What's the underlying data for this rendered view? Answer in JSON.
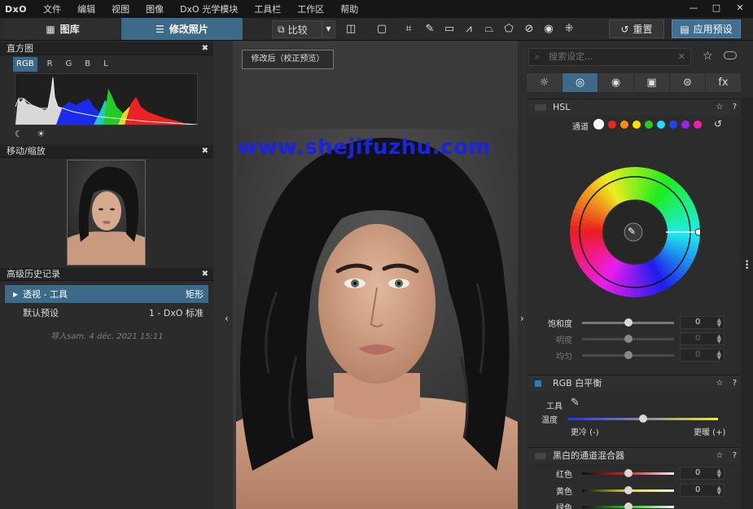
{
  "app": {
    "logo": "DxO",
    "menu": [
      "文件",
      "编辑",
      "视图",
      "图像",
      "DxO 光学模块",
      "工具栏",
      "工作区",
      "帮助"
    ],
    "window_controls": [
      "—",
      "□",
      "✕"
    ]
  },
  "toolbar": {
    "tab_library": "图库",
    "tab_edit": "修改照片",
    "compare_label": "比较",
    "reset_label": "重置",
    "apply_preset_label": "应用预设"
  },
  "histogram": {
    "title": "直方图",
    "channels": [
      "RGB",
      "R",
      "G",
      "B",
      "L"
    ],
    "active_channel": "RGB"
  },
  "navigator": {
    "title": "移动/缩放"
  },
  "history": {
    "title": "高级历史记录",
    "items": [
      {
        "label": "透视 - 工具",
        "value": "矩形",
        "selected": true
      },
      {
        "label": "默认预设",
        "value": "1 - DxO 标准",
        "selected": false
      }
    ],
    "import_note": "导入sam. 4 déc. 2021 15:11"
  },
  "viewer": {
    "corrected_label": "修改后（校正预览）",
    "watermark": "www.shejifuzhu.com"
  },
  "right_panel": {
    "search_placeholder": "搜索设定...",
    "palette_tabs": [
      "☼",
      "◎",
      "◉",
      "▣",
      "⊜",
      "fx"
    ],
    "active_palette_tab": 1,
    "hsl": {
      "title": "HSL",
      "channel_label": "通道",
      "channel_colors": [
        "#ffffff",
        "#ee2222",
        "#ff8a00",
        "#ffe000",
        "#22cc22",
        "#22ddee",
        "#2244ee",
        "#9a22ee",
        "#ee22aa"
      ],
      "sliders": [
        {
          "label": "饱和度",
          "value": "0",
          "level": 0.5,
          "dim": false
        },
        {
          "label": "明度",
          "value": "0",
          "level": 0.5,
          "dim": true
        },
        {
          "label": "均匀",
          "value": "0",
          "level": 0.5,
          "dim": true
        }
      ]
    },
    "white_balance": {
      "title": "RGB 白平衡",
      "tool_label": "工具",
      "temp_label": "温度",
      "temp_level": 0.5,
      "cooler_label": "更冷 (-)",
      "warmer_label": "更暖 (+)"
    },
    "bw_mixer": {
      "title": "黑白的通道混合器",
      "sliders": [
        {
          "label": "红色",
          "value": "0",
          "level": 0.5,
          "color": "#dd2222"
        },
        {
          "label": "黄色",
          "value": "0",
          "level": 0.5,
          "color": "#dddd22"
        },
        {
          "label": "绿色",
          "value": "0",
          "level": 0.5,
          "color": "#22cc22"
        }
      ]
    }
  }
}
